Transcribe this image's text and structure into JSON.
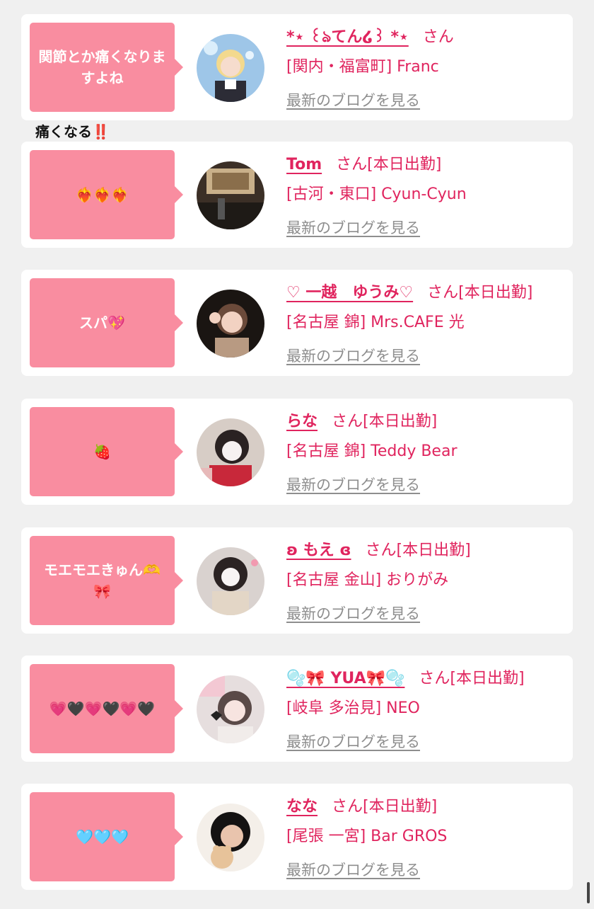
{
  "colors": {
    "accent": "#e0245e",
    "bubble": "#f98da0",
    "muted": "#8e8e8e",
    "background": "#f0f0f0"
  },
  "comment_between": "痛くなる‼️",
  "entries": [
    {
      "message": "関節とか痛くなりますよね",
      "name": "*⋆ ꒰ঌてん໒꒱ *⋆",
      "suffix": "さん",
      "status": "",
      "shop": "[関内・福富町] Franc",
      "blog_link": "最新のブログを見る"
    },
    {
      "message": "❤️‍🔥❤️‍🔥❤️‍🔥",
      "name": "Tom",
      "suffix": "さん",
      "status": "[本日出勤]",
      "shop": "[古河・東口] Cyun-Cyun",
      "blog_link": "最新のブログを見る"
    },
    {
      "message": "スパ💖",
      "name": "♡ 一越　ゆうみ♡",
      "suffix": "さん",
      "status": "[本日出勤]",
      "shop": "[名古屋 錦] Mrs.CAFE 光",
      "blog_link": "最新のブログを見る"
    },
    {
      "message": "🍓",
      "name": "らな",
      "suffix": "さん",
      "status": "[本日出勤]",
      "shop": "[名古屋 錦] Teddy Bear",
      "blog_link": "最新のブログを見る"
    },
    {
      "message": "モエモエきゅん🫶🎀",
      "name": "ʚ もえ ɞ",
      "suffix": "さん",
      "status": "[本日出勤]",
      "shop": "[名古屋 金山] おりがみ",
      "blog_link": "最新のブログを見る"
    },
    {
      "message": "💗🖤💗🖤💗🖤",
      "name": "🫧🎀 YUA🎀🫧",
      "suffix": "さん",
      "status": "[本日出勤]",
      "shop": "[岐阜 多治見] NEO",
      "blog_link": "最新のブログを見る"
    },
    {
      "message": "🩵🩵🩵",
      "name": "なな",
      "suffix": "さん",
      "status": "[本日出勤]",
      "shop": "[尾張 一宮] Bar GROS",
      "blog_link": "最新のブログを見る"
    }
  ]
}
